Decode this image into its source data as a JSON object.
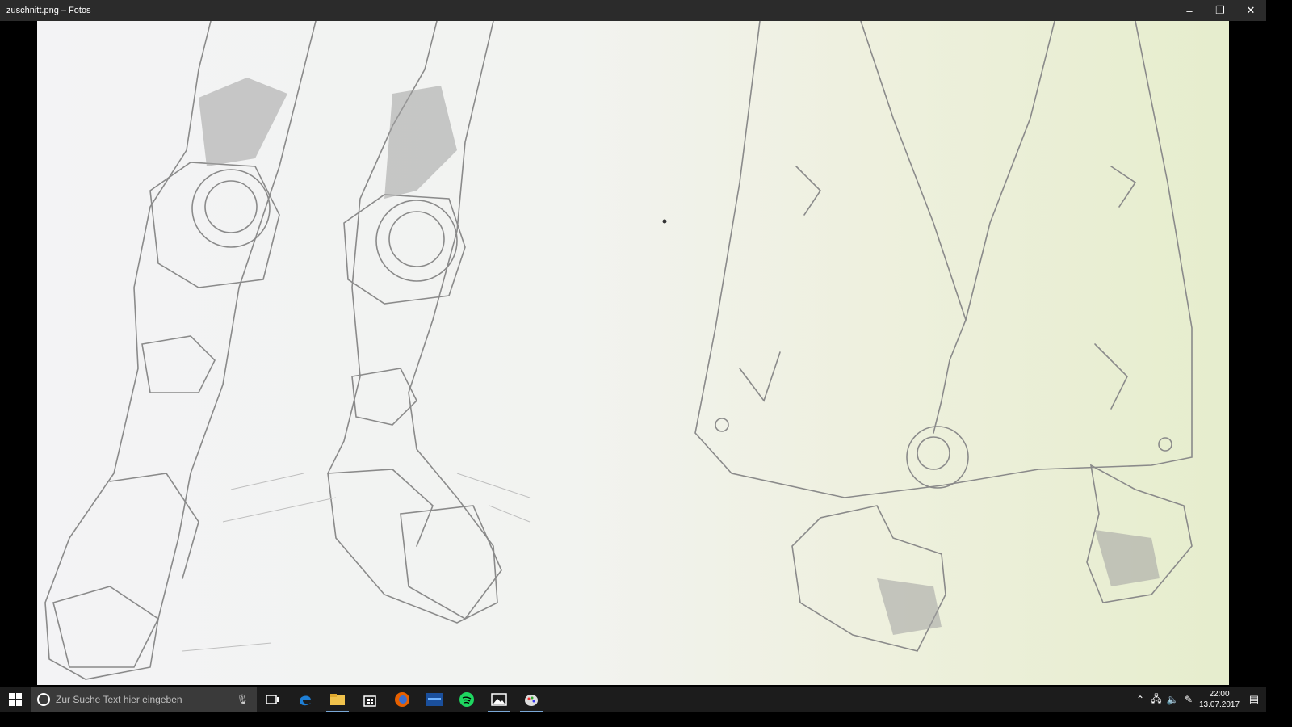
{
  "window": {
    "title": "zuschnitt.png – Fotos",
    "controls": {
      "minimize": "–",
      "restore": "❐",
      "close": "✕"
    }
  },
  "viewer": {
    "image_name": "zuschnitt.png"
  },
  "taskbar": {
    "search_placeholder": "Zur Suche Text hier eingeben",
    "apps": [
      {
        "name": "task-view",
        "icon": "task-view-icon",
        "active": false
      },
      {
        "name": "edge",
        "icon": "edge-icon",
        "active": false
      },
      {
        "name": "file-explorer",
        "icon": "folder-icon",
        "active": true
      },
      {
        "name": "store",
        "icon": "store-icon",
        "active": false
      },
      {
        "name": "firefox",
        "icon": "firefox-icon",
        "active": false
      },
      {
        "name": "blizzard",
        "icon": "blizzard-icon",
        "active": false
      },
      {
        "name": "spotify",
        "icon": "spotify-icon",
        "active": false
      },
      {
        "name": "photos",
        "icon": "photos-icon",
        "active": true
      },
      {
        "name": "paint",
        "icon": "paint-icon",
        "active": true
      }
    ],
    "tray": {
      "time": "22:00",
      "date": "13.07.2017"
    }
  }
}
